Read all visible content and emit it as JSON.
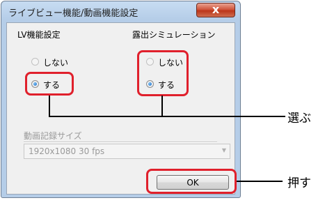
{
  "dialog": {
    "title": "ライブビュー機能/動画機能設定",
    "close_label": "x"
  },
  "lv_setting": {
    "label": "LV機能設定",
    "options": [
      "しない",
      "する"
    ],
    "selected": "する"
  },
  "exposure_sim": {
    "label": "露出シミュレーション",
    "options": [
      "しない",
      "する"
    ],
    "selected": "する"
  },
  "movie_size": {
    "label": "動画記録サイズ",
    "value": "1920x1080 30 fps",
    "enabled": false
  },
  "ok_label": "OK",
  "annotations": {
    "select_callout": "選ぶ",
    "press_callout": "押す"
  },
  "colors": {
    "highlight": "#e0202c",
    "titlebar": "#c7dcf2",
    "close_button": "#c8472b"
  }
}
